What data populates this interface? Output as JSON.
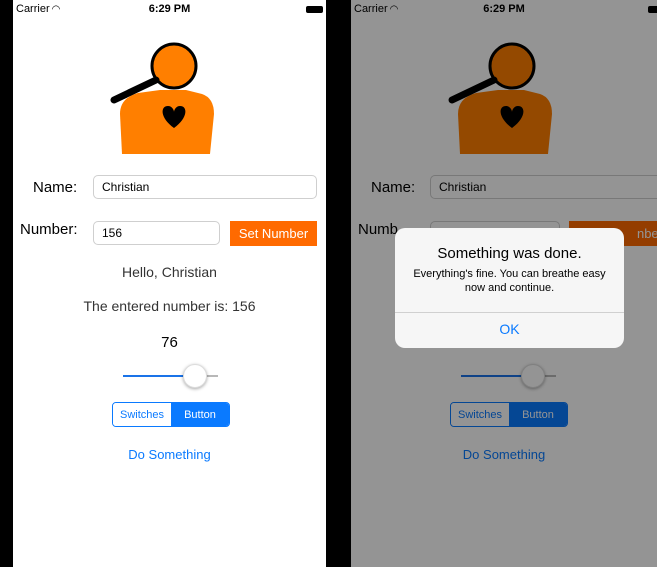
{
  "status_bar": {
    "carrier": "Carrier",
    "time": "6:29 PM"
  },
  "form": {
    "name_label": "Name:",
    "name_value": "Christian",
    "number_label": "Number:",
    "number_value": "156",
    "set_number_label": "Set Number",
    "right_set_number_fragment": "nber",
    "right_number_label_fragment": "Numb"
  },
  "output": {
    "greeting": "Hello, Christian",
    "entered_number": "The entered number is: 156",
    "slider_value": "76"
  },
  "slider": {
    "value": 76,
    "min": 0,
    "max": 100
  },
  "segmented": {
    "options": [
      "Switches",
      "Button"
    ],
    "selected": "Button"
  },
  "action_label": "Do Something",
  "alert": {
    "title": "Something was done.",
    "message": "Everything's fine. You can breathe easy now and continue.",
    "ok_label": "OK"
  },
  "colors": {
    "accent_blue": "#0a7aff",
    "brand_orange": "#ff6a00",
    "figure_orange": "#ff7f00"
  },
  "icons": {
    "wifi": "wifi-icon",
    "battery": "battery-icon",
    "logo": "magnifier-person-heart-logo"
  }
}
